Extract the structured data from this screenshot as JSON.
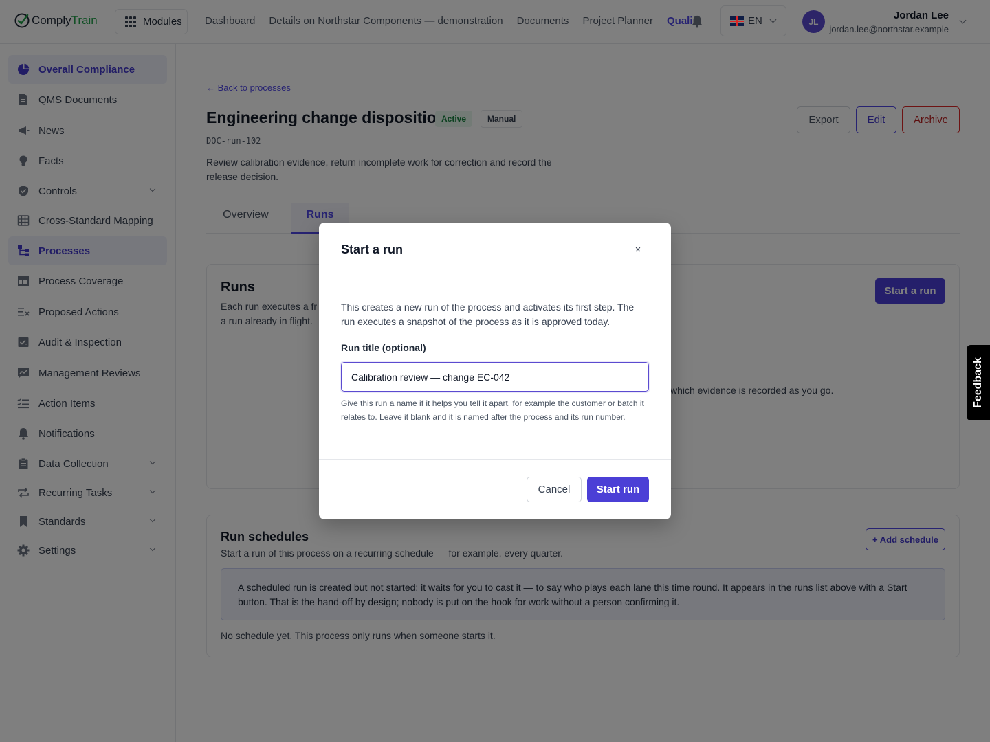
{
  "app": {
    "logo_part1": "Comply",
    "logo_part2": "Train",
    "modules_label": "Modules",
    "top_nav": [
      "Dashboard",
      "Details on Northstar Components — demonstration",
      "Documents",
      "Project Planner",
      "Quali"
    ],
    "language": "EN",
    "user": {
      "initials": "JL",
      "name": "Jordan Lee",
      "email": "jordan.lee@northstar.example"
    }
  },
  "sidebar": {
    "items": [
      {
        "label": "Overall Compliance",
        "icon": "pie-chart-icon",
        "active": true
      },
      {
        "label": "QMS Documents",
        "icon": "document-icon"
      },
      {
        "label": "News",
        "icon": "megaphone-icon"
      },
      {
        "label": "Facts",
        "icon": "lightbulb-icon"
      },
      {
        "label": "Controls",
        "icon": "shield-check-icon",
        "expandable": true
      },
      {
        "label": "Cross-Standard Mapping",
        "icon": "table-icon"
      },
      {
        "label": "Processes",
        "icon": "process-icon",
        "active": true
      },
      {
        "label": "Process Coverage",
        "icon": "table-layout-icon"
      },
      {
        "label": "Proposed Actions",
        "icon": "list-x-icon"
      },
      {
        "label": "Audit & Inspection",
        "icon": "clipboard-check-icon"
      },
      {
        "label": "Management Reviews",
        "icon": "chart-message-icon"
      },
      {
        "label": "Action Items",
        "icon": "checklist-icon"
      },
      {
        "label": "Notifications",
        "icon": "bell-icon"
      },
      {
        "label": "Data Collection",
        "icon": "clipboard-icon",
        "expandable": true
      },
      {
        "label": "Recurring Tasks",
        "icon": "repeat-icon",
        "expandable": true
      },
      {
        "label": "Standards",
        "icon": "bookmark-icon",
        "expandable": true
      },
      {
        "label": "Settings",
        "icon": "gear-icon",
        "expandable": true
      }
    ]
  },
  "page": {
    "back_link": "← Back to processes",
    "title": "Engineering change disposition",
    "status_badge": "Active",
    "type_badge": "Manual",
    "doc_code": "DOC-run-102",
    "description": "Review calibration evidence, return incomplete work for correction and record the release decision.",
    "actions": {
      "export": "Export",
      "edit": "Edit",
      "archive": "Archive"
    },
    "tabs": [
      {
        "label": "Overview"
      },
      {
        "label": "Runs",
        "active": true
      }
    ]
  },
  "runs_card": {
    "title": "Runs",
    "description_visible": "Each run executes a fr… a run already in flight.",
    "description_line1": "Each run executes a fr",
    "description_line2": "a run already in flight.",
    "start_button": "Start a run",
    "empty_text_visible": "which evidence is recorded as you go."
  },
  "schedules_card": {
    "title": "Run schedules",
    "description": "Start a run of this process on a recurring schedule — for example, every quarter.",
    "add_button": "+ Add schedule",
    "info": "A scheduled run is created but not started: it waits for you to cast it — to say who plays each lane this time round. It appears in the runs list above with a Start button. That is the hand-off by design; nobody is put on the hook for work without a person confirming it.",
    "empty": "No schedule yet. This process only runs when someone starts it."
  },
  "modal": {
    "title": "Start a run",
    "close": "×",
    "text": "This creates a new run of the process and activates its first step. The run executes a snapshot of the process as it is approved today.",
    "field_label": "Run title (optional)",
    "field_value": "Calibration review — change EC-042",
    "help": "Give this run a name if it helps you tell it apart, for example the customer or batch it relates to. Leave it blank and it is named after the process and its run number.",
    "cancel": "Cancel",
    "submit": "Start run"
  },
  "feedback_label": "Feedback",
  "colors": {
    "accent": "#4b3fd6",
    "brand_green": "#22a04a",
    "danger": "#dc2626"
  }
}
